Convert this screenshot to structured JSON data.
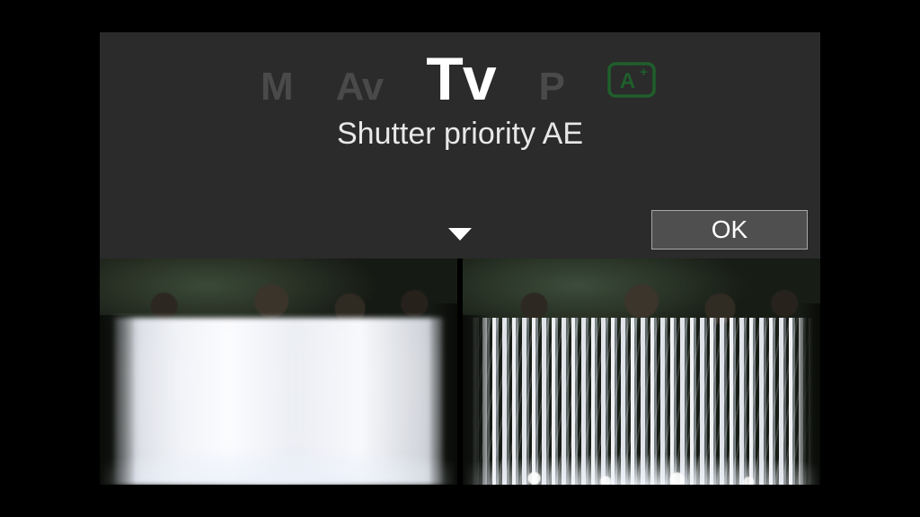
{
  "modes": {
    "m": "M",
    "av": "Av",
    "tv": "Tv",
    "p": "P",
    "auto_icon": "A+"
  },
  "selected_mode": "tv",
  "mode_description": "Shutter priority AE",
  "ok_label": "OK",
  "previews": {
    "left": "waterfall-slow-shutter",
    "right": "waterfall-fast-shutter"
  },
  "colors": {
    "panel_bg": "#2b2b2b",
    "inactive_mode": "#4a4a4a",
    "active_mode": "#ffffff",
    "auto_icon": "#1f5f2b",
    "ok_bg": "#4f4f4f",
    "ok_border": "#a8a8a8"
  }
}
